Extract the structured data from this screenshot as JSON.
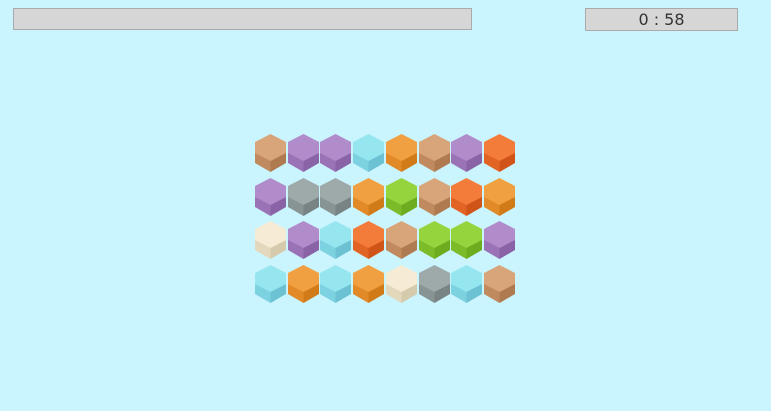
{
  "header": {
    "progress": 0,
    "timer": "0 : 58"
  },
  "palette": {
    "tan": {
      "top": "#d8a57a",
      "left": "#c08a5e",
      "right": "#b07a50"
    },
    "purple": {
      "top": "#b08cca",
      "left": "#9a72b6",
      "right": "#8a62a6"
    },
    "cyan": {
      "top": "#96e6f0",
      "left": "#7cd2e0",
      "right": "#6cc2d2"
    },
    "orange": {
      "top": "#f0a040",
      "left": "#e28a28",
      "right": "#d07a18"
    },
    "red": {
      "top": "#f47c3a",
      "left": "#e26424",
      "right": "#d05418"
    },
    "gray": {
      "top": "#9eaaaa",
      "left": "#889494",
      "right": "#788484"
    },
    "green": {
      "top": "#96d43e",
      "left": "#7cbc2a",
      "right": "#6cac1e"
    },
    "cream": {
      "top": "#f6ecd6",
      "left": "#e4d8bc",
      "right": "#d6caac"
    }
  },
  "board": {
    "rows": [
      [
        "tan",
        "purple",
        "purple",
        "cyan",
        "orange",
        "tan",
        "purple",
        "red"
      ],
      [
        "purple",
        "gray",
        "gray",
        "orange",
        "green",
        "tan",
        "red",
        "orange"
      ],
      [
        "cream",
        "purple",
        "cyan",
        "red",
        "tan",
        "green",
        "green",
        "purple"
      ],
      [
        "cyan",
        "orange",
        "cyan",
        "orange",
        "cream",
        "gray",
        "cyan",
        "tan"
      ]
    ]
  }
}
